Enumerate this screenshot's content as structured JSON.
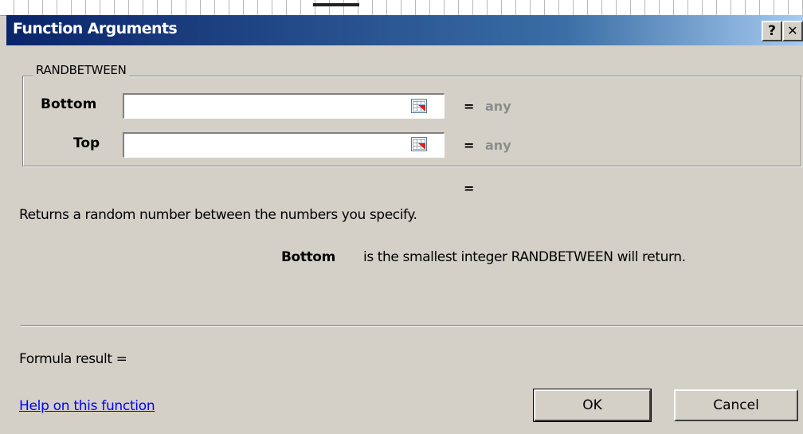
{
  "dialog": {
    "title": "Function Arguments",
    "help_glyph": "?",
    "close_glyph": "✕"
  },
  "function": {
    "name": "RANDBETWEEN",
    "args": [
      {
        "label": "Bottom",
        "value": "",
        "result": "any"
      },
      {
        "label": "Top",
        "value": "",
        "result": "any"
      }
    ],
    "equals": "=",
    "overall_result": "",
    "description": "Returns a random number between the numbers you specify.",
    "arg_help_name": "Bottom",
    "arg_help_text": "is the smallest integer RANDBETWEEN will return."
  },
  "footer": {
    "formula_result_label": "Formula result =",
    "formula_result_value": "",
    "help_link": "Help on this function",
    "ok_label": "OK",
    "cancel_label": "Cancel"
  },
  "icons": {
    "ref_button": "collapse-dialog-icon"
  },
  "colors": {
    "titlebar_start": "#0a246a",
    "titlebar_end": "#a6caf0",
    "dialog_bg": "#d4d0c8",
    "muted_text": "#8c8c8c",
    "link": "#0000ff"
  }
}
